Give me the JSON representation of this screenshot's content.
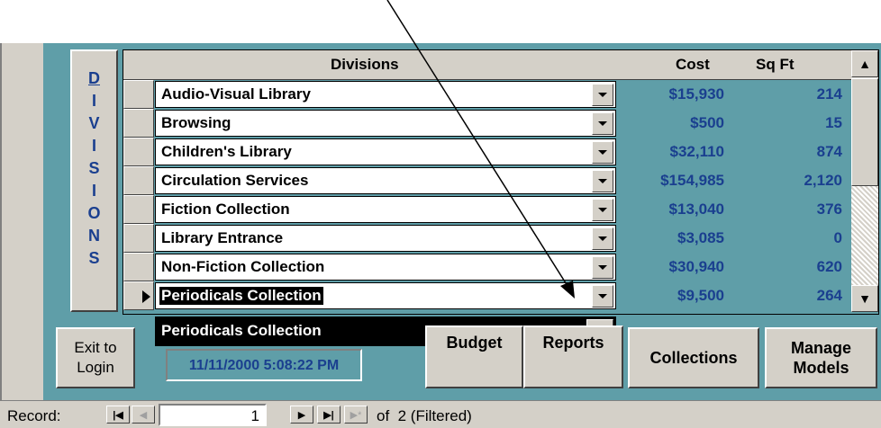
{
  "side_tab": {
    "letters": [
      "D",
      "I",
      "V",
      "I",
      "S",
      "I",
      "O",
      "N",
      "S"
    ]
  },
  "grid": {
    "headers": {
      "divisions": "Divisions",
      "cost": "Cost",
      "sqft": "Sq Ft"
    },
    "rows": [
      {
        "division": "Audio-Visual Library",
        "cost": "$15,930",
        "sqft": "214"
      },
      {
        "division": "Browsing",
        "cost": "$500",
        "sqft": "15"
      },
      {
        "division": "Children's Library",
        "cost": "$32,110",
        "sqft": "874"
      },
      {
        "division": "Circulation Services",
        "cost": "$154,985",
        "sqft": "2,120"
      },
      {
        "division": "Fiction Collection",
        "cost": "$13,040",
        "sqft": "376"
      },
      {
        "division": "Library Entrance",
        "cost": "$3,085",
        "sqft": "0"
      },
      {
        "division": "Non-Fiction Collection",
        "cost": "$30,940",
        "sqft": "620"
      },
      {
        "division": "Periodicals Collection",
        "cost": "$9,500",
        "sqft": "264"
      }
    ],
    "dropdown_list": [
      "Periodicals Collection"
    ]
  },
  "footer": {
    "exit_line1": "Exit to",
    "exit_line2": "Login",
    "datetime": "11/11/2000 5:08:22 PM",
    "budget": "Budget",
    "reports": "Reports",
    "collections": "Collections",
    "manage_line1": "Manage",
    "manage_line2": "Models"
  },
  "navigator": {
    "label": "Record:",
    "current": "1",
    "of_text": "of  2 (Filtered)"
  },
  "colors": {
    "teal": "#5f9ea8",
    "face": "#d4d0c8",
    "value_text": "#1a3f8f",
    "selected": "#000000"
  }
}
